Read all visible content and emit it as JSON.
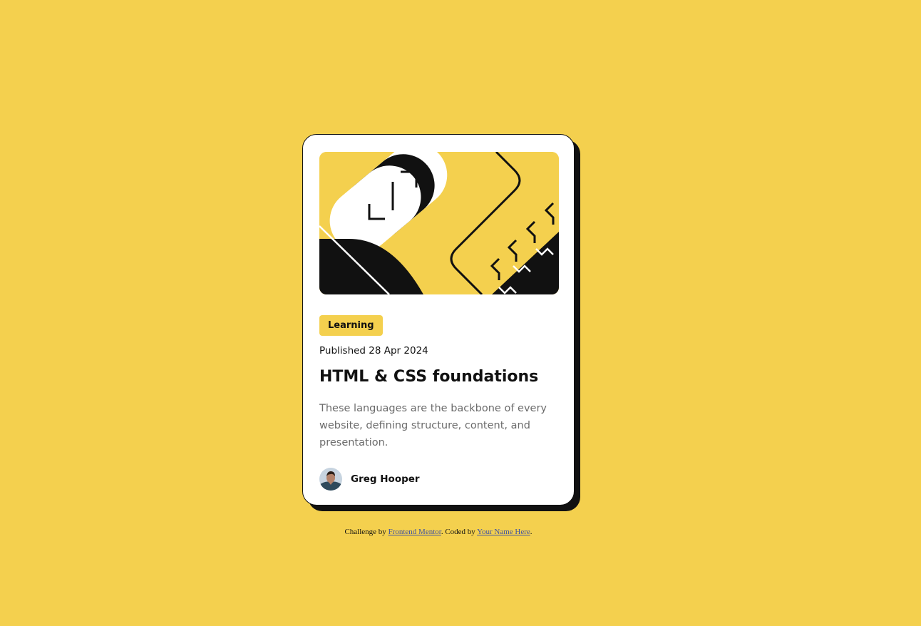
{
  "card": {
    "tag": "Learning",
    "published": "Published 28 Apr 2024",
    "title": "HTML & CSS foundations",
    "description": "These languages are the backbone of every website, defining structure, content, and presentation.",
    "author": {
      "name": "Greg Hooper"
    }
  },
  "attribution": {
    "prefix": "Challenge by ",
    "challenge_link": "Frontend Mentor",
    "middle": ". Coded by ",
    "author_link": "Your Name Here",
    "suffix": "."
  },
  "colors": {
    "background": "#f4d04e",
    "card": "#ffffff",
    "ink": "#111111",
    "muted_text": "#6b6b6b",
    "link": "#3e52a3"
  },
  "icons": {
    "hero": "html-css-illustration",
    "avatar": "author-avatar"
  }
}
